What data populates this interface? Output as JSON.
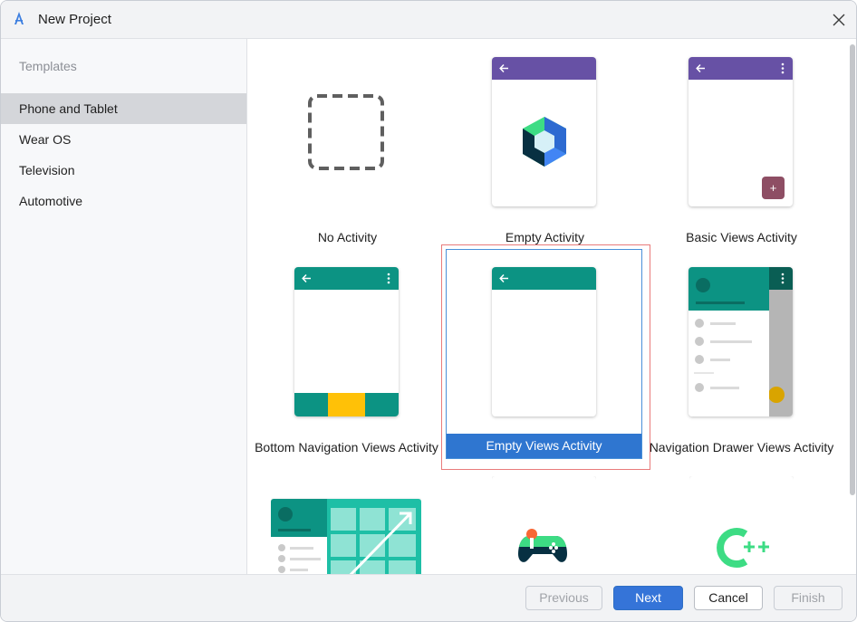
{
  "window": {
    "title": "New Project"
  },
  "sidebar": {
    "heading": "Templates",
    "items": [
      {
        "label": "Phone and Tablet",
        "selected": true
      },
      {
        "label": "Wear OS",
        "selected": false
      },
      {
        "label": "Television",
        "selected": false
      },
      {
        "label": "Automotive",
        "selected": false
      }
    ]
  },
  "templates": [
    {
      "label": "No Activity"
    },
    {
      "label": "Empty Activity"
    },
    {
      "label": "Basic Views Activity"
    },
    {
      "label": "Bottom Navigation Views Activity"
    },
    {
      "label": "Empty Views Activity",
      "selected": true
    },
    {
      "label": "Navigation Drawer Views Activity"
    }
  ],
  "footer": {
    "previous_label": "Previous",
    "next_label": "Next",
    "cancel_label": "Cancel",
    "finish_label": "Finish"
  },
  "colors": {
    "accent": "#3574d8",
    "purple_bar": "#6751a5",
    "teal_bar": "#0c9383",
    "fab": "#8e4e64",
    "bottom_nav_highlight": "#ffc107"
  },
  "icons": {
    "app": "android-studio-icon",
    "close": "close-icon"
  }
}
